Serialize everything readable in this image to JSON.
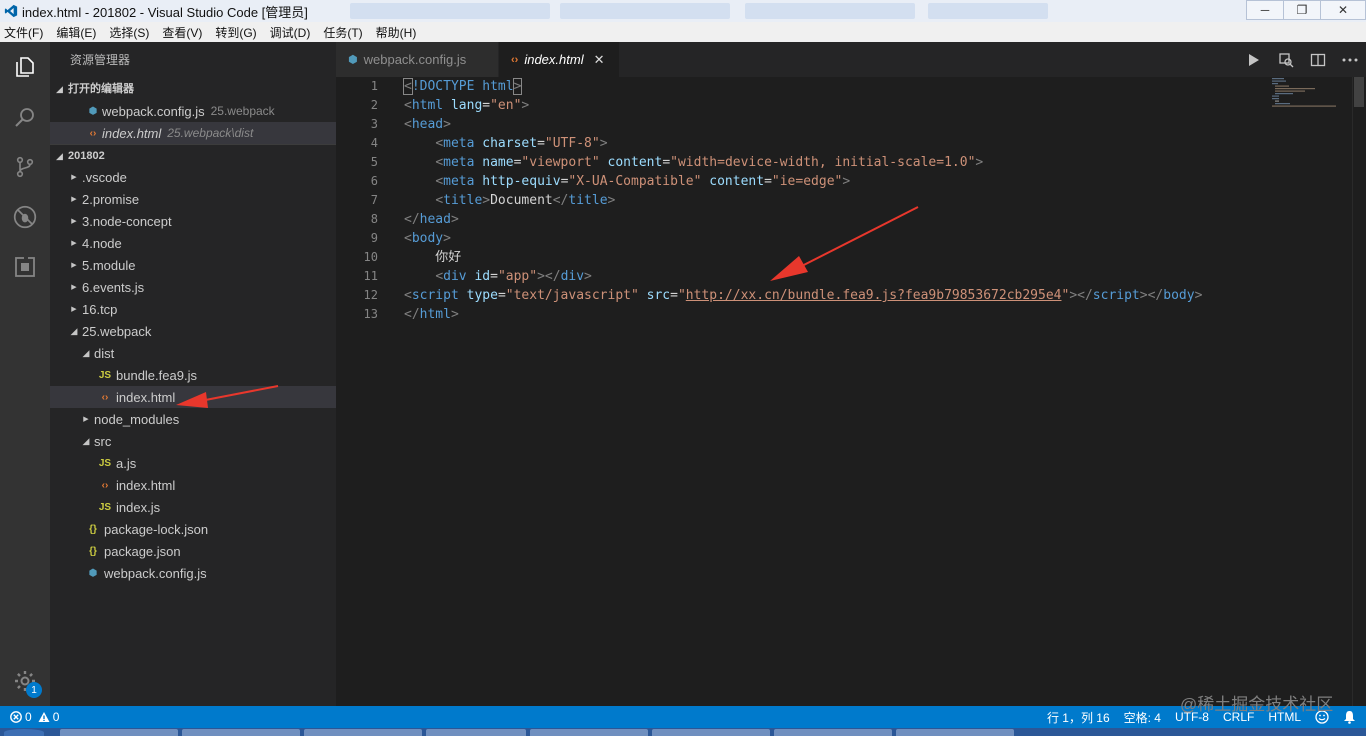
{
  "window": {
    "title": "index.html - 201802 - Visual Studio Code [管理员]",
    "controls": {
      "minimize": "─",
      "maximize": "❐",
      "close": "✕"
    }
  },
  "menu": [
    "文件(F)",
    "编辑(E)",
    "选择(S)",
    "查看(V)",
    "转到(G)",
    "调试(D)",
    "任务(T)",
    "帮助(H)"
  ],
  "activity": {
    "icons": [
      "files-icon",
      "search-icon",
      "source-control-icon",
      "debug-icon",
      "extensions-icon"
    ],
    "settings_badge": "1"
  },
  "sidebar": {
    "title": "资源管理器",
    "open_editors": {
      "header": "打开的编辑器",
      "items": [
        {
          "name": "webpack.config.js",
          "desc": "25.webpack",
          "type": "webpack"
        },
        {
          "name": "index.html",
          "desc": "25.webpack\\dist",
          "type": "html"
        }
      ]
    },
    "folder": {
      "header": "201802",
      "items": [
        {
          "name": ".vscode",
          "type": "folder",
          "depth": 0,
          "expanded": false
        },
        {
          "name": "2.promise",
          "type": "folder",
          "depth": 0,
          "expanded": false
        },
        {
          "name": "3.node-concept",
          "type": "folder",
          "depth": 0,
          "expanded": false
        },
        {
          "name": "4.node",
          "type": "folder",
          "depth": 0,
          "expanded": false
        },
        {
          "name": "5.module",
          "type": "folder",
          "depth": 0,
          "expanded": false
        },
        {
          "name": "6.events.js",
          "type": "folder",
          "depth": 0,
          "expanded": false
        },
        {
          "name": "16.tcp",
          "type": "folder",
          "depth": 0,
          "expanded": false
        },
        {
          "name": "25.webpack",
          "type": "folder",
          "depth": 0,
          "expanded": true
        },
        {
          "name": "dist",
          "type": "folder",
          "depth": 1,
          "expanded": true
        },
        {
          "name": "bundle.fea9.js",
          "type": "js",
          "depth": 2
        },
        {
          "name": "index.html",
          "type": "html",
          "depth": 2,
          "selected": true
        },
        {
          "name": "node_modules",
          "type": "folder",
          "depth": 1,
          "expanded": false
        },
        {
          "name": "src",
          "type": "folder",
          "depth": 1,
          "expanded": true
        },
        {
          "name": "a.js",
          "type": "js",
          "depth": 2
        },
        {
          "name": "index.html",
          "type": "html",
          "depth": 2
        },
        {
          "name": "index.js",
          "type": "js",
          "depth": 2
        },
        {
          "name": "package-lock.json",
          "type": "json",
          "depth": 1
        },
        {
          "name": "package.json",
          "type": "json",
          "depth": 1
        },
        {
          "name": "webpack.config.js",
          "type": "webpack",
          "depth": 1
        }
      ]
    }
  },
  "tabs": [
    {
      "label": "webpack.config.js",
      "type": "webpack",
      "active": false
    },
    {
      "label": "index.html",
      "type": "html",
      "active": true,
      "close": "✕"
    }
  ],
  "editor": {
    "lines": [
      [
        [
          "punct",
          "<"
        ],
        [
          "tag",
          "!DOCTYPE"
        ],
        [
          "text",
          " "
        ],
        [
          "tag",
          "html"
        ],
        [
          "punct",
          ">"
        ]
      ],
      [
        [
          "punct",
          "<"
        ],
        [
          "tag",
          "html"
        ],
        [
          "text",
          " "
        ],
        [
          "attr",
          "lang"
        ],
        [
          "text",
          "="
        ],
        [
          "str",
          "\"en\""
        ],
        [
          "punct",
          ">"
        ]
      ],
      [
        [
          "punct",
          "<"
        ],
        [
          "tag",
          "head"
        ],
        [
          "punct",
          ">"
        ]
      ],
      [
        [
          "text",
          "    "
        ],
        [
          "punct",
          "<"
        ],
        [
          "tag",
          "meta"
        ],
        [
          "text",
          " "
        ],
        [
          "attr",
          "charset"
        ],
        [
          "text",
          "="
        ],
        [
          "str",
          "\"UTF-8\""
        ],
        [
          "punct",
          ">"
        ]
      ],
      [
        [
          "text",
          "    "
        ],
        [
          "punct",
          "<"
        ],
        [
          "tag",
          "meta"
        ],
        [
          "text",
          " "
        ],
        [
          "attr",
          "name"
        ],
        [
          "text",
          "="
        ],
        [
          "str",
          "\"viewport\""
        ],
        [
          "text",
          " "
        ],
        [
          "attr",
          "content"
        ],
        [
          "text",
          "="
        ],
        [
          "str",
          "\"width=device-width, initial-scale=1.0\""
        ],
        [
          "punct",
          ">"
        ]
      ],
      [
        [
          "text",
          "    "
        ],
        [
          "punct",
          "<"
        ],
        [
          "tag",
          "meta"
        ],
        [
          "text",
          " "
        ],
        [
          "attr",
          "http-equiv"
        ],
        [
          "text",
          "="
        ],
        [
          "str",
          "\"X-UA-Compatible\""
        ],
        [
          "text",
          " "
        ],
        [
          "attr",
          "content"
        ],
        [
          "text",
          "="
        ],
        [
          "str",
          "\"ie=edge\""
        ],
        [
          "punct",
          ">"
        ]
      ],
      [
        [
          "text",
          "    "
        ],
        [
          "punct",
          "<"
        ],
        [
          "tag",
          "title"
        ],
        [
          "punct",
          ">"
        ],
        [
          "text",
          "Document"
        ],
        [
          "punct",
          "</"
        ],
        [
          "tag",
          "title"
        ],
        [
          "punct",
          ">"
        ]
      ],
      [
        [
          "punct",
          "</"
        ],
        [
          "tag",
          "head"
        ],
        [
          "punct",
          ">"
        ]
      ],
      [
        [
          "punct",
          "<"
        ],
        [
          "tag",
          "body"
        ],
        [
          "punct",
          ">"
        ]
      ],
      [
        [
          "text",
          "    你好"
        ]
      ],
      [
        [
          "text",
          "    "
        ],
        [
          "punct",
          "<"
        ],
        [
          "tag",
          "div"
        ],
        [
          "text",
          " "
        ],
        [
          "attr",
          "id"
        ],
        [
          "text",
          "="
        ],
        [
          "str",
          "\"app\""
        ],
        [
          "punct",
          "></"
        ],
        [
          "tag",
          "div"
        ],
        [
          "punct",
          ">"
        ]
      ],
      [
        [
          "punct",
          "<"
        ],
        [
          "tag",
          "script"
        ],
        [
          "text",
          " "
        ],
        [
          "attr",
          "type"
        ],
        [
          "text",
          "="
        ],
        [
          "str",
          "\"text/javascript\""
        ],
        [
          "text",
          " "
        ],
        [
          "attr",
          "src"
        ],
        [
          "text",
          "="
        ],
        [
          "str",
          "\""
        ],
        [
          "url",
          "http://xx.cn/bundle.fea9.js?fea9b79853672cb295e4"
        ],
        [
          "str",
          "\""
        ],
        [
          "punct",
          "></"
        ],
        [
          "tag",
          "script"
        ],
        [
          "punct",
          "></"
        ],
        [
          "tag",
          "body"
        ],
        [
          "punct",
          ">"
        ]
      ],
      [
        [
          "punct",
          "</"
        ],
        [
          "tag",
          "html"
        ],
        [
          "punct",
          ">"
        ]
      ]
    ]
  },
  "status": {
    "errors": "0",
    "warnings": "0",
    "position": "行 1，列 16",
    "indent": "空格: 4",
    "encoding": "UTF-8",
    "eol": "CRLF",
    "language": "HTML"
  },
  "watermark": "@稀土掘金技术社区",
  "colors": {
    "accent": "#007acc",
    "annotation": "#e8372c"
  }
}
